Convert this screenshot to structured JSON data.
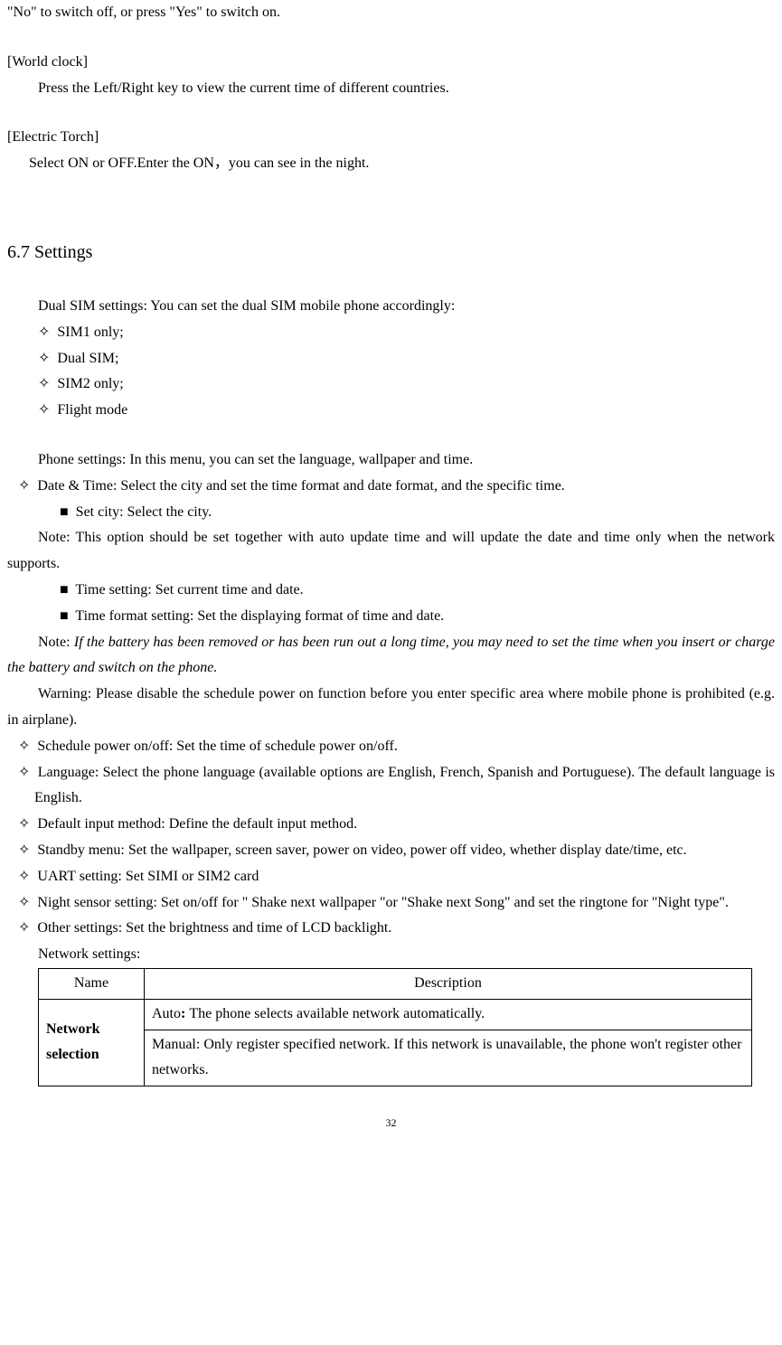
{
  "intro": {
    "line1": "\"No\" to switch off, or press \"Yes\" to switch on.",
    "worldClockHeader": "[World clock]",
    "worldClockBody": "Press the Left/Right key to view the current time of different countries.",
    "torchHeader": "[Electric Torch]",
    "torchBody": "Select ON or OFF.Enter the ON，you can see in the night."
  },
  "section": {
    "heading": "6.7 Settings",
    "dualSimIntro": "Dual SIM settings: You can set the dual SIM mobile phone accordingly:",
    "dualSimItems": [
      "SIM1 only;",
      "Dual SIM;",
      "SIM2 only;",
      "Flight mode"
    ],
    "phoneSettingsIntro": "Phone settings: In this menu, you can set the language, wallpaper and time.",
    "dateTime": "Date & Time: Select the city and set the time format and date format, and the specific time.",
    "setCity": "Set city: Select the city.",
    "noteCity": "Note: This option should be set together with auto update time and will update the date and time only when the network supports.",
    "timeSetting": "Time setting: Set current time and date.",
    "timeFormat": "Time format setting: Set the displaying format of time and date.",
    "noteBatteryLead": "Note: ",
    "noteBattery": "If the battery has been removed or has been run out a long time, you may need to set the time when you insert or charge the battery and switch on the phone.",
    "warning": "Warning: Please disable the schedule power on function before you enter specific area where mobile phone is prohibited (e.g. in airplane).",
    "schedule": "Schedule power on/off: Set the time of schedule power on/off.",
    "language": "Language: Select the phone language (available options are English, French, Spanish and Portuguese). The default language is English.",
    "inputMethod": "Default input method: Define the default input method.",
    "standby": "Standby menu: Set the wallpaper, screen saver, power on video, power off video, whether display date/time, etc.",
    "uart": "UART setting: Set SIMI or SIM2 card",
    "nightSensor": "Night sensor setting: Set on/off   for \" Shake next wallpaper \"or \"Shake next Song\" and set the ringtone for \"Night type\".",
    "otherSettings": "Other settings: Set the brightness and time of LCD backlight.",
    "networkSettings": "Network settings:"
  },
  "table": {
    "nameHeader": "Name",
    "descHeader": "Description",
    "rowLabel": "Network selection",
    "autoLead": "Auto",
    "autoColon": ": ",
    "autoRest": "The phone selects available network automatically.",
    "manual": "Manual: Only register specified network. If this network is unavailable, the phone won't register other networks."
  },
  "pageNumber": "32",
  "glyphs": {
    "diamond": "✧",
    "square": "■"
  }
}
